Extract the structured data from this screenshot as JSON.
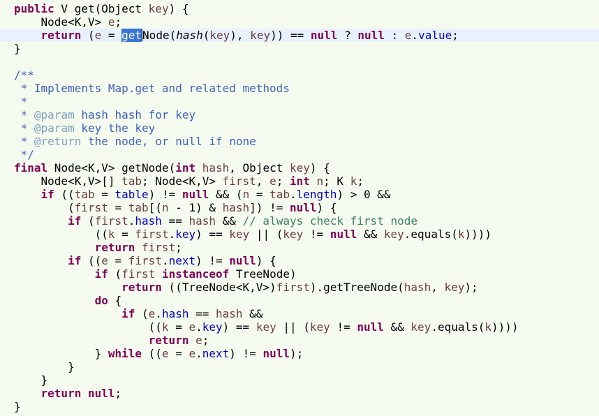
{
  "editor": {
    "caret_line": 3,
    "lines": [
      [
        [
          "kw",
          "public"
        ],
        [
          "t",
          " V get("
        ],
        [
          "t",
          "Object "
        ],
        [
          "par",
          "key"
        ],
        [
          "t",
          ") {"
        ]
      ],
      [
        [
          "t",
          "    Node<K,V> "
        ],
        [
          "par",
          "e"
        ],
        [
          "t",
          ";"
        ]
      ],
      [
        [
          "t",
          "    "
        ],
        [
          "kw",
          "return"
        ],
        [
          "t",
          " ("
        ],
        [
          "par",
          "e"
        ],
        [
          "t",
          " = "
        ],
        [
          "sel",
          "get"
        ],
        [
          "caret",
          ""
        ],
        [
          "t",
          "Node("
        ],
        [
          "ital",
          "hash"
        ],
        [
          "t",
          "("
        ],
        [
          "par",
          "key"
        ],
        [
          "t",
          "), "
        ],
        [
          "par",
          "key"
        ],
        [
          "t",
          ")) == "
        ],
        [
          "kw",
          "null"
        ],
        [
          "t",
          " ? "
        ],
        [
          "kw",
          "null"
        ],
        [
          "t",
          " : "
        ],
        [
          "par",
          "e"
        ],
        [
          "t",
          "."
        ],
        [
          "fld",
          "value"
        ],
        [
          "t",
          ";"
        ]
      ],
      [
        [
          "t",
          "}"
        ]
      ],
      [
        [
          "t",
          ""
        ]
      ],
      [
        [
          "jdoc",
          "/**"
        ]
      ],
      [
        [
          "jdoc",
          " * Implements Map.get and related methods"
        ]
      ],
      [
        [
          "jdoc",
          " *"
        ]
      ],
      [
        [
          "jdoc",
          " * "
        ],
        [
          "jtag",
          "@param"
        ],
        [
          "jdoc",
          " hash hash for key"
        ]
      ],
      [
        [
          "jdoc",
          " * "
        ],
        [
          "jtag",
          "@param"
        ],
        [
          "jdoc",
          " key the key"
        ]
      ],
      [
        [
          "jdoc",
          " * "
        ],
        [
          "jtag",
          "@return"
        ],
        [
          "jdoc",
          " the node, or null if none"
        ]
      ],
      [
        [
          "jdoc",
          " */"
        ]
      ],
      [
        [
          "kw",
          "final"
        ],
        [
          "t",
          " Node<K,V> getNode("
        ],
        [
          "kw",
          "int"
        ],
        [
          "t",
          " "
        ],
        [
          "par",
          "hash"
        ],
        [
          "t",
          ", Object "
        ],
        [
          "par",
          "key"
        ],
        [
          "t",
          ") {"
        ]
      ],
      [
        [
          "t",
          "    Node<K,V>[] "
        ],
        [
          "par",
          "tab"
        ],
        [
          "t",
          "; Node<K,V> "
        ],
        [
          "par",
          "first"
        ],
        [
          "t",
          ", "
        ],
        [
          "par",
          "e"
        ],
        [
          "t",
          "; "
        ],
        [
          "kw",
          "int"
        ],
        [
          "t",
          " "
        ],
        [
          "par",
          "n"
        ],
        [
          "t",
          "; K "
        ],
        [
          "par",
          "k"
        ],
        [
          "t",
          ";"
        ]
      ],
      [
        [
          "t",
          "    "
        ],
        [
          "kw",
          "if"
        ],
        [
          "t",
          " (("
        ],
        [
          "par",
          "tab"
        ],
        [
          "t",
          " = "
        ],
        [
          "fld",
          "table"
        ],
        [
          "t",
          ") != "
        ],
        [
          "kw",
          "null"
        ],
        [
          "t",
          " && ("
        ],
        [
          "par",
          "n"
        ],
        [
          "t",
          " = "
        ],
        [
          "par",
          "tab"
        ],
        [
          "t",
          "."
        ],
        [
          "fld",
          "length"
        ],
        [
          "t",
          ") > 0 &&"
        ]
      ],
      [
        [
          "t",
          "        ("
        ],
        [
          "par",
          "first"
        ],
        [
          "t",
          " = "
        ],
        [
          "par",
          "tab"
        ],
        [
          "t",
          "[("
        ],
        [
          "par",
          "n"
        ],
        [
          "t",
          " - 1) & "
        ],
        [
          "par",
          "hash"
        ],
        [
          "t",
          "]) != "
        ],
        [
          "kw",
          "null"
        ],
        [
          "t",
          ") {"
        ]
      ],
      [
        [
          "t",
          "        "
        ],
        [
          "kw",
          "if"
        ],
        [
          "t",
          " ("
        ],
        [
          "par",
          "first"
        ],
        [
          "t",
          "."
        ],
        [
          "fld",
          "hash"
        ],
        [
          "t",
          " == "
        ],
        [
          "par",
          "hash"
        ],
        [
          "t",
          " && "
        ],
        [
          "cmt",
          "// always check first node"
        ]
      ],
      [
        [
          "t",
          "            (("
        ],
        [
          "par",
          "k"
        ],
        [
          "t",
          " = "
        ],
        [
          "par",
          "first"
        ],
        [
          "t",
          "."
        ],
        [
          "fld",
          "key"
        ],
        [
          "t",
          ") == "
        ],
        [
          "par",
          "key"
        ],
        [
          "t",
          " || ("
        ],
        [
          "par",
          "key"
        ],
        [
          "t",
          " != "
        ],
        [
          "kw",
          "null"
        ],
        [
          "t",
          " && "
        ],
        [
          "par",
          "key"
        ],
        [
          "t",
          ".equals("
        ],
        [
          "par",
          "k"
        ],
        [
          "t",
          "))))"
        ]
      ],
      [
        [
          "t",
          "            "
        ],
        [
          "kw",
          "return"
        ],
        [
          "t",
          " "
        ],
        [
          "par",
          "first"
        ],
        [
          "t",
          ";"
        ]
      ],
      [
        [
          "t",
          "        "
        ],
        [
          "kw",
          "if"
        ],
        [
          "t",
          " (("
        ],
        [
          "par",
          "e"
        ],
        [
          "t",
          " = "
        ],
        [
          "par",
          "first"
        ],
        [
          "t",
          "."
        ],
        [
          "fld",
          "next"
        ],
        [
          "t",
          ") != "
        ],
        [
          "kw",
          "null"
        ],
        [
          "t",
          ") {"
        ]
      ],
      [
        [
          "t",
          "            "
        ],
        [
          "kw",
          "if"
        ],
        [
          "t",
          " ("
        ],
        [
          "par",
          "first"
        ],
        [
          "t",
          " "
        ],
        [
          "kw",
          "instanceof"
        ],
        [
          "t",
          " TreeNode)"
        ]
      ],
      [
        [
          "t",
          "                "
        ],
        [
          "kw",
          "return"
        ],
        [
          "t",
          " ((TreeNode<K,V>)"
        ],
        [
          "par",
          "first"
        ],
        [
          "t",
          ").getTreeNode("
        ],
        [
          "par",
          "hash"
        ],
        [
          "t",
          ", "
        ],
        [
          "par",
          "key"
        ],
        [
          "t",
          ");"
        ]
      ],
      [
        [
          "t",
          "            "
        ],
        [
          "kw",
          "do"
        ],
        [
          "t",
          " {"
        ]
      ],
      [
        [
          "t",
          "                "
        ],
        [
          "kw",
          "if"
        ],
        [
          "t",
          " ("
        ],
        [
          "par",
          "e"
        ],
        [
          "t",
          "."
        ],
        [
          "fld",
          "hash"
        ],
        [
          "t",
          " == "
        ],
        [
          "par",
          "hash"
        ],
        [
          "t",
          " &&"
        ]
      ],
      [
        [
          "t",
          "                    (("
        ],
        [
          "par",
          "k"
        ],
        [
          "t",
          " = "
        ],
        [
          "par",
          "e"
        ],
        [
          "t",
          "."
        ],
        [
          "fld",
          "key"
        ],
        [
          "t",
          ") == "
        ],
        [
          "par",
          "key"
        ],
        [
          "t",
          " || ("
        ],
        [
          "par",
          "key"
        ],
        [
          "t",
          " != "
        ],
        [
          "kw",
          "null"
        ],
        [
          "t",
          " && "
        ],
        [
          "par",
          "key"
        ],
        [
          "t",
          ".equals("
        ],
        [
          "par",
          "k"
        ],
        [
          "t",
          "))))"
        ]
      ],
      [
        [
          "t",
          "                    "
        ],
        [
          "kw",
          "return"
        ],
        [
          "t",
          " "
        ],
        [
          "par",
          "e"
        ],
        [
          "t",
          ";"
        ]
      ],
      [
        [
          "t",
          "            } "
        ],
        [
          "kw",
          "while"
        ],
        [
          "t",
          " (("
        ],
        [
          "par",
          "e"
        ],
        [
          "t",
          " = "
        ],
        [
          "par",
          "e"
        ],
        [
          "t",
          "."
        ],
        [
          "fld",
          "next"
        ],
        [
          "t",
          ") != "
        ],
        [
          "kw",
          "null"
        ],
        [
          "t",
          ");"
        ]
      ],
      [
        [
          "t",
          "        }"
        ]
      ],
      [
        [
          "t",
          "    }"
        ]
      ],
      [
        [
          "t",
          "    "
        ],
        [
          "kw",
          "return"
        ],
        [
          "t",
          " "
        ],
        [
          "kw",
          "null"
        ],
        [
          "t",
          ";"
        ]
      ],
      [
        [
          "t",
          "}"
        ]
      ]
    ]
  }
}
